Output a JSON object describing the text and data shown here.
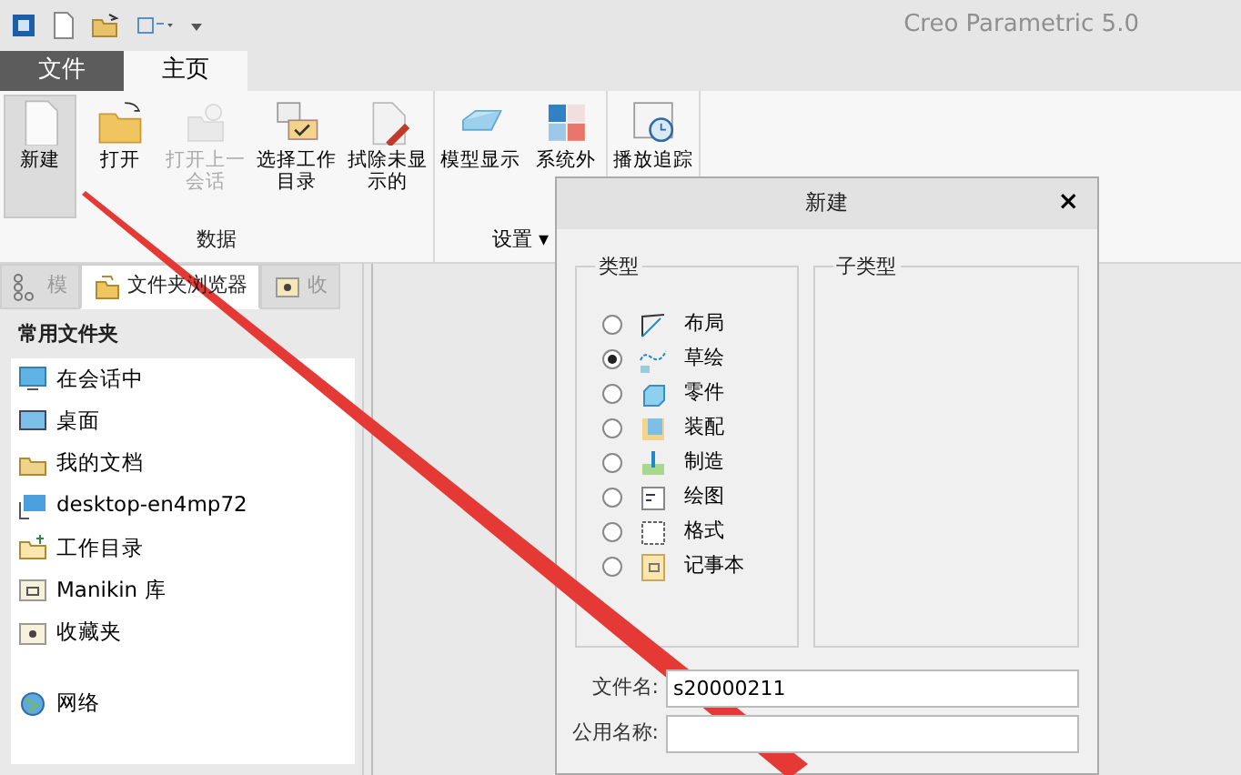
{
  "window": {
    "title": "Creo Parametric 5.0"
  },
  "ribbon_tabs": [
    {
      "label": "文件",
      "kind": "file",
      "selected": false
    },
    {
      "label": "主页",
      "kind": "tab",
      "selected": true
    }
  ],
  "ribbon_groups": [
    {
      "label": "数据",
      "buttons": [
        {
          "label": "新建",
          "selected": true,
          "disabled": false
        },
        {
          "label": "打开",
          "selected": false,
          "disabled": false
        },
        {
          "label": "打开上一会话",
          "selected": false,
          "disabled": true
        },
        {
          "label": "选择工作目录",
          "selected": false,
          "disabled": false
        },
        {
          "label": "拭除未显示的",
          "selected": false,
          "disabled": false
        }
      ]
    },
    {
      "label": "设置",
      "dropdown_caret": "▾",
      "buttons": [
        {
          "label": "模型显示",
          "selected": false,
          "disabled": false
        },
        {
          "label": "系统外",
          "selected": false,
          "disabled": false
        }
      ]
    },
    {
      "buttons": [
        {
          "label": "播放追踪",
          "selected": false,
          "disabled": false
        }
      ]
    }
  ],
  "navigator": {
    "tabs": [
      {
        "label": "模",
        "selected": false
      },
      {
        "label": "文件夹浏览器",
        "selected": true
      },
      {
        "label": "收",
        "selected": false
      }
    ],
    "heading": "常用文件夹",
    "items": [
      {
        "label": "在会话中"
      },
      {
        "label": "桌面"
      },
      {
        "label": "我的文档"
      },
      {
        "label": "desktop-en4mp72"
      },
      {
        "label": "工作目录"
      },
      {
        "label": "Manikin 库"
      },
      {
        "label": "收藏夹"
      }
    ],
    "network": {
      "label": "网络"
    }
  },
  "dialog": {
    "title": "新建",
    "close": "×",
    "type_group": "类型",
    "subtype_group": "子类型",
    "types": [
      {
        "label": "布局",
        "selected": false
      },
      {
        "label": "草绘",
        "selected": true
      },
      {
        "label": "零件",
        "selected": false
      },
      {
        "label": "装配",
        "selected": false
      },
      {
        "label": "制造",
        "selected": false
      },
      {
        "label": "绘图",
        "selected": false
      },
      {
        "label": "格式",
        "selected": false
      },
      {
        "label": "记事本",
        "selected": false
      }
    ],
    "fields": [
      {
        "label": "文件名:",
        "value": "s20000211"
      },
      {
        "label": "公用名称:"
      }
    ]
  }
}
